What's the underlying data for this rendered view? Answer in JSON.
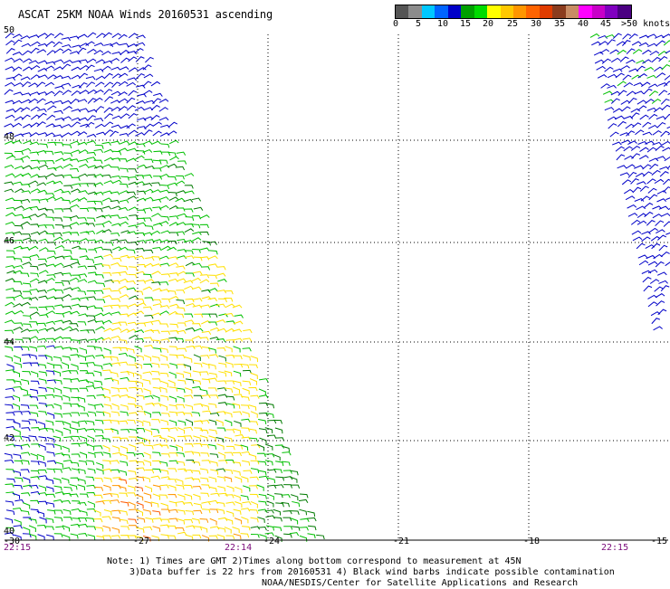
{
  "title": "ASCAT 25KM NOAA Winds 20160531 ascending",
  "legend": {
    "labels": [
      "0",
      "5",
      "10",
      "15",
      "20",
      "25",
      "30",
      "35",
      "40",
      "45",
      ">50 knots"
    ],
    "colors": [
      "#555555",
      "#8c8c8c",
      "#00c8ff",
      "#0064ff",
      "#0000c8",
      "#00a000",
      "#00dc00",
      "#ffff00",
      "#ffc800",
      "#ff9600",
      "#ff6400",
      "#e03c00",
      "#8b3c1e",
      "#c88c64",
      "#ff00ff",
      "#c800c8",
      "#8000c0",
      "#4b0082"
    ]
  },
  "map": {
    "lat_labels": [
      "50",
      "48",
      "46",
      "44",
      "42",
      "40"
    ],
    "lon_labels": [
      "-30",
      "-27",
      "-24",
      "-21",
      "-18",
      "-15"
    ],
    "time_labels": [
      "22:15",
      "22:14",
      "22:15"
    ],
    "swath_colors": {
      "blue": "#0000c8",
      "green": "#00c000",
      "darkgreen": "#007a00",
      "yellow": "#ffe000",
      "orange": "#ff9600",
      "red": "#ff5a00"
    }
  },
  "notes": {
    "line1": "Note: 1) Times are GMT 2)Times along bottom correspond to measurement at 45N",
    "line2": "3)Data buffer is 22 hrs from 20160531 4) Black wind barbs indicate possible contamination",
    "line3": "NOAA/NESDIS/Center for Satellite Applications and Research"
  }
}
